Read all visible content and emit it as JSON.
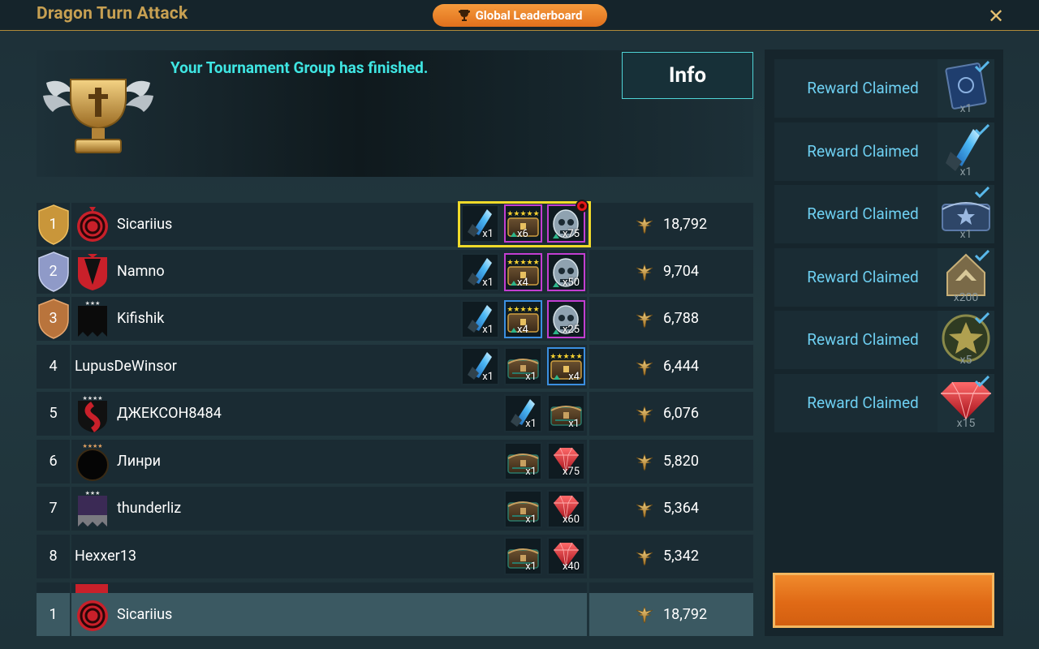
{
  "header": {
    "title": "Dragon Turn Attack",
    "global_button_label": "Global Leaderboard",
    "close_symbol": "✕"
  },
  "banner": {
    "message": "Your Tournament Group has finished.",
    "info_button_label": "Info"
  },
  "leaderboard": [
    {
      "rank": "1",
      "name": "Sicariius",
      "points": "18,792",
      "rewards": [
        {
          "icon": "blue-shard",
          "qty": "x1"
        },
        {
          "icon": "chest",
          "qty": "x6"
        },
        {
          "icon": "skull-potion",
          "qty": "x75"
        }
      ]
    },
    {
      "rank": "2",
      "name": "Namno",
      "points": "9,704",
      "rewards": [
        {
          "icon": "blue-shard",
          "qty": "x1"
        },
        {
          "icon": "chest",
          "qty": "x4"
        },
        {
          "icon": "skull-potion",
          "qty": "x50"
        }
      ]
    },
    {
      "rank": "3",
      "name": "Kifishik",
      "points": "6,788",
      "rewards": [
        {
          "icon": "blue-shard",
          "qty": "x1"
        },
        {
          "icon": "chest",
          "qty": "x4"
        },
        {
          "icon": "skull-potion",
          "qty": "x25"
        }
      ]
    },
    {
      "rank": "4",
      "name": "LupusDeWinsor",
      "points": "6,444",
      "rewards": [
        {
          "icon": "blue-shard",
          "qty": "x1"
        },
        {
          "icon": "chest",
          "qty": "x1"
        },
        {
          "icon": "chest",
          "qty": "x4"
        }
      ]
    },
    {
      "rank": "5",
      "name": "ДЖЕКСОН8484",
      "points": "6,076",
      "rewards": [
        {
          "icon": "blue-shard",
          "qty": "x1"
        },
        {
          "icon": "chest",
          "qty": "x1"
        }
      ]
    },
    {
      "rank": "6",
      "name": "Линри",
      "points": "5,820",
      "rewards": [
        {
          "icon": "chest",
          "qty": "x1"
        },
        {
          "icon": "ruby",
          "qty": "x75"
        }
      ]
    },
    {
      "rank": "7",
      "name": "thunderliz",
      "points": "5,364",
      "rewards": [
        {
          "icon": "chest",
          "qty": "x1"
        },
        {
          "icon": "ruby",
          "qty": "x60"
        }
      ]
    },
    {
      "rank": "8",
      "name": "Hexxer13",
      "points": "5,342",
      "rewards": [
        {
          "icon": "chest",
          "qty": "x1"
        },
        {
          "icon": "ruby",
          "qty": "x40"
        }
      ]
    }
  ],
  "self_row": {
    "rank": "1",
    "name": "Sicariius",
    "points": "18,792"
  },
  "claimed_rewards": [
    {
      "label": "Reward Claimed",
      "icon": "tome",
      "qty": "x1"
    },
    {
      "label": "Reward Claimed",
      "icon": "blue-shard",
      "qty": "x1"
    },
    {
      "label": "Reward Claimed",
      "icon": "chest",
      "qty": "x1"
    },
    {
      "label": "Reward Claimed",
      "icon": "rank-up-token",
      "qty": "x200"
    },
    {
      "label": "Reward Claimed",
      "icon": "star-medal",
      "qty": "x5"
    },
    {
      "label": "Reward Claimed",
      "icon": "ruby",
      "qty": "x15"
    }
  ],
  "colors": {
    "accent_gold": "#c7a052",
    "cyan_text": "#3fe6e3",
    "claim_text": "#6ed0f2",
    "orange_button": "#e0701c",
    "highlight": "#f0db2a"
  }
}
